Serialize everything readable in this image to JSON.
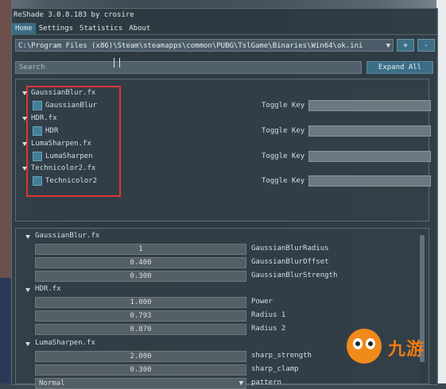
{
  "title": "ReShade 3.0.8.183 by crosire",
  "menu": [
    "Home",
    "Settings",
    "Statistics",
    "About"
  ],
  "preset_path": "C:\\Program Files (x86)\\Steam\\steamapps\\common\\PUBG\\TslGame\\Binaries\\Win64\\ok.ini",
  "preset_add": "+",
  "preset_remove": "-",
  "search_placeholder": "Search",
  "expand_all": "Expand All",
  "toggle_key_label": "Toggle Key",
  "effects": [
    {
      "file": "GaussianBlur.fx",
      "technique": "GaussianBlur"
    },
    {
      "file": "HDR.fx",
      "technique": "HDR"
    },
    {
      "file": "LumaSharpen.fx",
      "technique": "LumaSharpen"
    },
    {
      "file": "Technicolor2.fx",
      "technique": "Technicolor2"
    }
  ],
  "settings": [
    {
      "file": "GaussianBlur.fx",
      "params": [
        {
          "name": "GaussianBlurRadius",
          "value": "1"
        },
        {
          "name": "GaussianBlurOffset",
          "value": "0.400"
        },
        {
          "name": "GaussianBlurStrength",
          "value": "0.300"
        }
      ]
    },
    {
      "file": "HDR.fx",
      "params": [
        {
          "name": "Power",
          "value": "1.000"
        },
        {
          "name": "Radius 1",
          "value": "0.793"
        },
        {
          "name": "Radius 2",
          "value": "0.870"
        }
      ]
    },
    {
      "file": "LumaSharpen.fx",
      "params": [
        {
          "name": "sharp_strength",
          "value": "2.000"
        },
        {
          "name": "sharp_clamp",
          "value": "0.300"
        },
        {
          "name": "pattern",
          "value": "Normal"
        }
      ]
    }
  ],
  "watermark": "九游",
  "colors": {
    "accent": "#3b6e86",
    "highlight_box": "#e03434",
    "brand_orange": "#ef7b12"
  }
}
